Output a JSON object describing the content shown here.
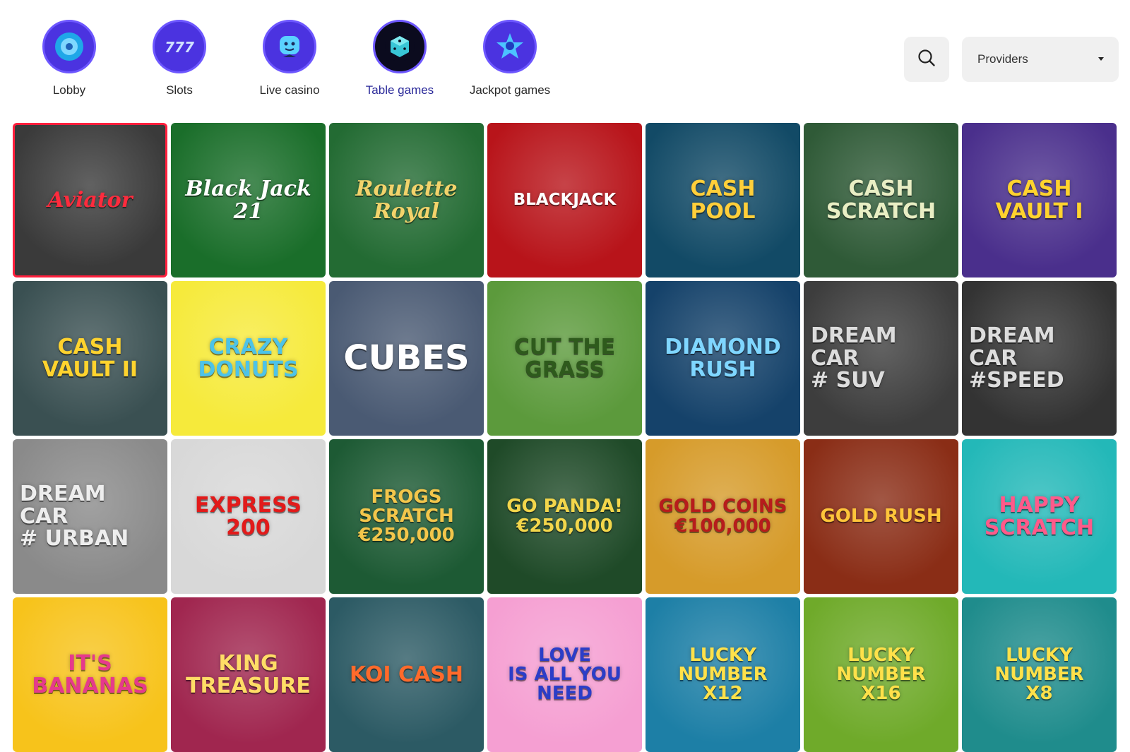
{
  "categories": [
    {
      "name": "cat-lobby",
      "label": "Lobby",
      "icon": "chip-icon",
      "active": false
    },
    {
      "name": "cat-slots",
      "label": "Slots",
      "icon": "slot-777-icon",
      "active": false
    },
    {
      "name": "cat-live-casino",
      "label": "Live casino",
      "icon": "robot-dealer-icon",
      "active": false
    },
    {
      "name": "cat-table-games",
      "label": "Table games",
      "icon": "dice-icon",
      "active": true
    },
    {
      "name": "cat-jackpot-games",
      "label": "Jackpot games",
      "icon": "star-icon",
      "active": false
    }
  ],
  "search": {
    "icon": "search-icon"
  },
  "providers": {
    "label": "Providers",
    "icon": "caret-down-icon"
  },
  "games": [
    {
      "title": "Aviator",
      "bg": "#3a3a3a",
      "fg": "#ff2b3d",
      "cls": "serif"
    },
    {
      "title": "Black Jack\n21",
      "bg": "#1a6e2a",
      "fg": "#ffffff",
      "cls": "serif"
    },
    {
      "title": "Roulette\nRoyal",
      "bg": "#236b33",
      "fg": "#f3d36b",
      "cls": "serif"
    },
    {
      "title": "BLACKJACK",
      "bg": "#b8141a",
      "fg": "#ffffff",
      "cls": "tiny"
    },
    {
      "title": "CASH\nPOOL",
      "bg": "#124a66",
      "fg": "#ffcf3a",
      "cls": ""
    },
    {
      "title": "CASH\nSCRATCH",
      "bg": "#2f5a37",
      "fg": "#e9eec4",
      "cls": ""
    },
    {
      "title": "CASH\nVAULT I",
      "bg": "#4a2f8c",
      "fg": "#ffd32e",
      "cls": ""
    },
    {
      "title": "CASH\nVAULT II",
      "bg": "#3a5052",
      "fg": "#ffd32e",
      "cls": ""
    },
    {
      "title": "CRAZY\nDONUTS",
      "bg": "#f6ea3b",
      "fg": "#4dc3e8",
      "cls": ""
    },
    {
      "title": "CUBES",
      "bg": "#4a5a73",
      "fg": "#ffffff",
      "cls": "big"
    },
    {
      "title": "CUT THE\nGRASS",
      "bg": "#5c9a3c",
      "fg": "#2e5a1c",
      "cls": ""
    },
    {
      "title": "DIAMOND\nRUSH",
      "bg": "#15426a",
      "fg": "#7fd6ff",
      "cls": ""
    },
    {
      "title": "DREAM CAR\n# SUV",
      "bg": "#3d3d3d",
      "fg": "#dddddd",
      "cls": "left"
    },
    {
      "title": "DREAM CAR\n#SPEED",
      "bg": "#333333",
      "fg": "#dddddd",
      "cls": "left"
    },
    {
      "title": "DREAM CAR\n# URBAN",
      "bg": "#8a8a8a",
      "fg": "#eeeeee",
      "cls": "left"
    },
    {
      "title": "EXPRESS\n200",
      "bg": "#d8d8d8",
      "fg": "#e21a1a",
      "cls": ""
    },
    {
      "title": "FROGS\nSCRATCH\n€250,000",
      "bg": "#1d5a34",
      "fg": "#f3c64b",
      "cls": "small"
    },
    {
      "title": "GO PANDA!\n€250,000",
      "bg": "#1f4a28",
      "fg": "#f3d64b",
      "cls": "small"
    },
    {
      "title": "GOLD COINS\n€100,000",
      "bg": "#d69b2a",
      "fg": "#b71c1c",
      "cls": "small"
    },
    {
      "title": "GOLD RUSH",
      "bg": "#8a2d16",
      "fg": "#ffc53a",
      "cls": "small"
    },
    {
      "title": "HAPPY\nSCRATCH",
      "bg": "#23b8b8",
      "fg": "#ff5a8a",
      "cls": ""
    },
    {
      "title": "IT'S\nBANANAS",
      "bg": "#f7c31b",
      "fg": "#e63a8c",
      "cls": ""
    },
    {
      "title": "KING\nTREASURE",
      "bg": "#a0264f",
      "fg": "#ffdd66",
      "cls": ""
    },
    {
      "title": "KOI CASH",
      "bg": "#2c5a64",
      "fg": "#ff6a2b",
      "cls": ""
    },
    {
      "title": "LOVE\nIS ALL YOU NEED",
      "bg": "#f59fd2",
      "fg": "#2b3dc8",
      "cls": "small"
    },
    {
      "title": "LUCKY NUMBER\nX12",
      "bg": "#1d7fa6",
      "fg": "#ffe14a",
      "cls": "small"
    },
    {
      "title": "LUCKY NUMBER\nX16",
      "bg": "#6faa2a",
      "fg": "#ffe14a",
      "cls": "small"
    },
    {
      "title": "LUCKY NUMBER\nX8",
      "bg": "#1f8c8c",
      "fg": "#ffe14a",
      "cls": "small"
    }
  ]
}
